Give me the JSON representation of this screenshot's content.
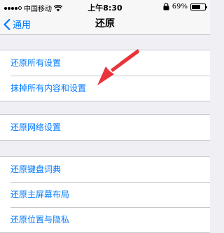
{
  "status_bar": {
    "carrier": "中国移动",
    "time": "上午8:30",
    "battery_percent": "69%",
    "battery_level": 0.69,
    "signal_bars": 4,
    "icons": [
      "signal-icon",
      "wifi-icon",
      "lock-rotation-icon",
      "battery-icon"
    ]
  },
  "nav": {
    "back_label": "通用",
    "title": "还原"
  },
  "groups": [
    {
      "items": [
        "还原所有设置",
        "抹掉所有内容和设置"
      ]
    },
    {
      "items": [
        "还原网络设置"
      ]
    },
    {
      "items": [
        "还原键盘词典",
        "还原主屏幕布局",
        "还原位置与隐私"
      ]
    }
  ],
  "annotation": {
    "color": "#e8343a",
    "points_to": "抹掉所有内容和设置"
  },
  "colors": {
    "accent": "#007aff",
    "background": "#efeff4"
  }
}
